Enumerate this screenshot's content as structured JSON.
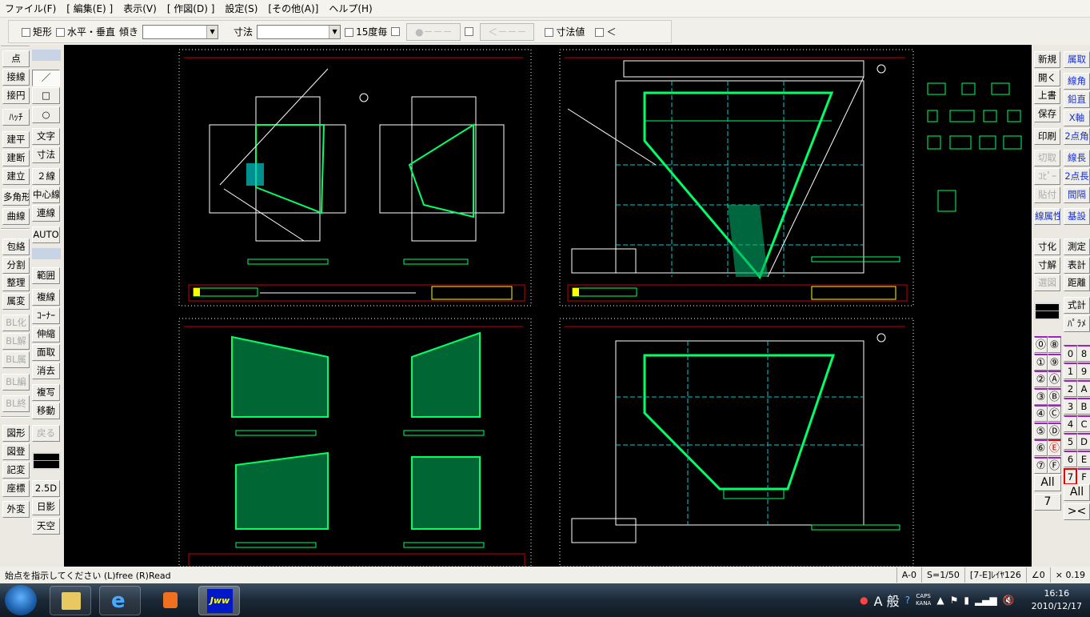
{
  "menu": [
    "ファイル(F)",
    "[ 編集(E) ]",
    "表示(V)",
    "[ 作図(D) ]",
    "設定(S)",
    "[その他(A)]",
    "ヘルプ(H)"
  ],
  "toolbar": {
    "rect": "矩形",
    "hv": "水平・垂直",
    "tilt": "傾き",
    "tilt_value": "",
    "dim": "寸法",
    "dim_value": "",
    "deg15": "15度毎",
    "btn1": "●－－－",
    "btn2": "＜－－－",
    "dimval": "寸法値",
    "lt": "＜"
  },
  "left_col1": [
    {
      "l": "点"
    },
    {
      "l": "接線"
    },
    {
      "l": "接円"
    },
    {
      "l": "ﾊｯﾁ"
    },
    {
      "l": "建平"
    },
    {
      "l": "建断"
    },
    {
      "l": "建立"
    },
    {
      "l": "多角形"
    },
    {
      "l": "曲線"
    },
    {
      "l": "包絡"
    },
    {
      "l": "分割"
    },
    {
      "l": "整理"
    },
    {
      "l": "属変"
    },
    {
      "l": "BL化",
      "d": 1
    },
    {
      "l": "BL解",
      "d": 1
    },
    {
      "l": "BL属",
      "d": 1
    },
    {
      "l": "BL編",
      "d": 1
    },
    {
      "l": "BL終",
      "d": 1
    },
    {
      "l": "図形"
    },
    {
      "l": "図登"
    },
    {
      "l": "記変"
    },
    {
      "l": "座標"
    },
    {
      "l": "外変"
    }
  ],
  "left_col2": [
    {
      "l": "／",
      "s": 1
    },
    {
      "l": "□"
    },
    {
      "l": "○"
    },
    {
      "l": "文字"
    },
    {
      "l": "寸法"
    },
    {
      "l": "２線"
    },
    {
      "l": "中心線"
    },
    {
      "l": "連線"
    },
    {
      "l": "AUTO"
    },
    {
      "l": "範囲"
    },
    {
      "l": "複線"
    },
    {
      "l": "ｺｰﾅｰ"
    },
    {
      "l": "伸縮"
    },
    {
      "l": "面取"
    },
    {
      "l": "消去"
    },
    {
      "l": "複写"
    },
    {
      "l": "移動"
    },
    {
      "l": "戻る",
      "d": 1
    },
    {
      "l": "2.5D"
    },
    {
      "l": "日影"
    },
    {
      "l": "天空"
    }
  ],
  "right_col1": [
    {
      "l": "新規"
    },
    {
      "l": "開く"
    },
    {
      "l": "上書"
    },
    {
      "l": "保存"
    },
    {
      "l": "印刷"
    },
    {
      "l": "切取",
      "d": 1
    },
    {
      "l": "ｺﾋﾟｰ",
      "d": 1
    },
    {
      "l": "貼付",
      "d": 1
    },
    {
      "l": "線属性",
      "b": 1
    },
    {
      "l": "寸化"
    },
    {
      "l": "寸解"
    },
    {
      "l": "選図",
      "d": 1
    }
  ],
  "right_col2": [
    {
      "l": "属取",
      "b": 1
    },
    {
      "l": "線角",
      "b": 1
    },
    {
      "l": "鉛直",
      "b": 1
    },
    {
      "l": "X軸",
      "b": 1
    },
    {
      "l": "2点角",
      "b": 1
    },
    {
      "l": "線長",
      "b": 1
    },
    {
      "l": "2点長",
      "b": 1
    },
    {
      "l": "間隔",
      "b": 1
    },
    {
      "l": "基設",
      "b": 1
    },
    {
      "l": "測定"
    },
    {
      "l": "表計"
    },
    {
      "l": "距離"
    },
    {
      "l": "式計"
    },
    {
      "l": "ﾊﾟﾗﾒ"
    }
  ],
  "layer_groups": [
    "⓪",
    "⑧",
    "①",
    "⑨",
    "②",
    "Ⓐ",
    "③",
    "Ⓑ",
    "④",
    "Ⓒ",
    "⑤",
    "Ⓓ",
    "⑥",
    "Ⓔ",
    "⑦",
    "Ⓕ"
  ],
  "layer_groups_all": "All",
  "layer_group_current": "7",
  "layers": [
    "0",
    "8",
    "1",
    "9",
    "2",
    "A",
    "3",
    "B",
    "4",
    "C",
    "5",
    "D",
    "6",
    "E",
    "7",
    "F"
  ],
  "layers_all": "All",
  "layers_swap": "><",
  "active_layer_group": "E",
  "active_layer": "7",
  "status": {
    "message": "始点を指示してください (L)free (R)Read",
    "paper": "A-0",
    "scale": "S=1/50",
    "layer": "[7-E]ﾚｲﾔ126",
    "angle": "∠0",
    "zoom": "× 0.19"
  },
  "taskbar": {
    "ime": "A 般",
    "caps": "CAPS",
    "kana": "KANA",
    "time": "16:16",
    "date": "2010/12/17",
    "active_app": "Jww"
  },
  "colors": {
    "drawing_bg": "#000000",
    "line_green": "#00ff66",
    "line_cyan": "#00ffff",
    "sheet_red": "#c00000",
    "title_yellow": "#ffff00"
  }
}
